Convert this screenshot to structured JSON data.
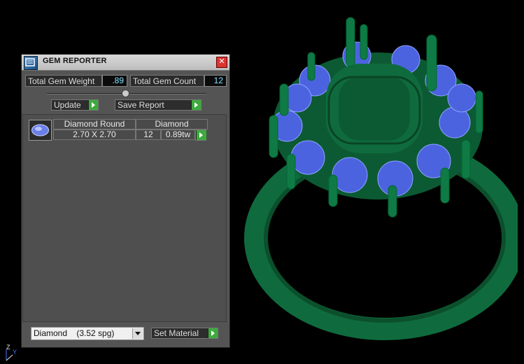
{
  "panel": {
    "title": "GEM REPORTER",
    "close_glyph": "✕",
    "total_weight_label": "Total Gem Weight",
    "total_weight_value": ".89",
    "total_count_label": "Total Gem Count",
    "total_count_value": "12",
    "update_label": "Update",
    "save_report_label": "Save Report",
    "gem_row": {
      "shape": "Diamond Round",
      "size": "2.70 X 2.70",
      "material": "Diamond",
      "count": "12",
      "weight": "0.89tw"
    },
    "material_select": "Diamond    (3.52 spg)",
    "set_material_label": "Set Material"
  },
  "axis": {
    "z": "Z",
    "y": "Y"
  },
  "colors": {
    "ring_green": "#0f6b3d",
    "gem_blue": "#4c63e0",
    "accent_cyan": "#7fe0ff"
  }
}
